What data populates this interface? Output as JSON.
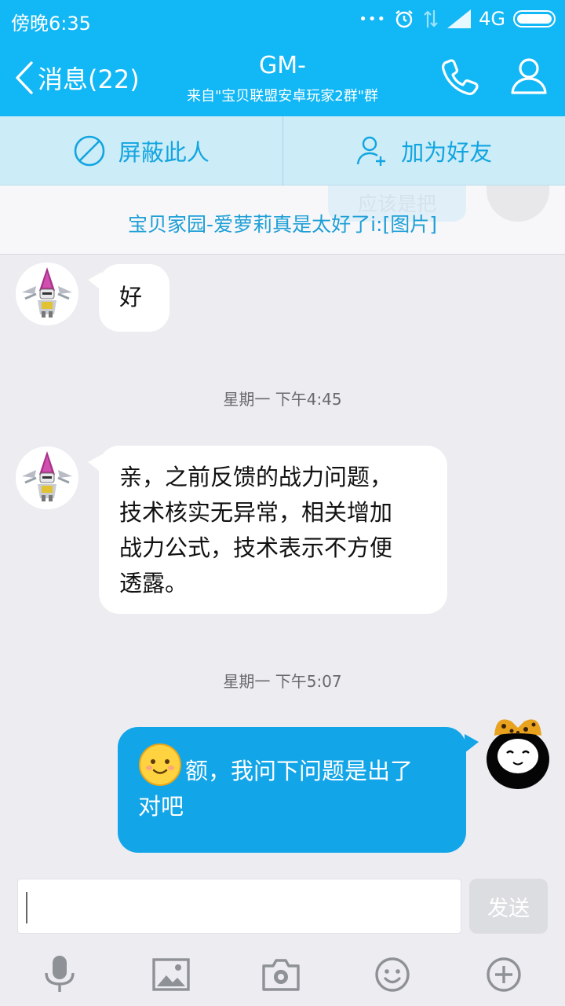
{
  "status_bar": {
    "time": "傍晚6:35",
    "dots": "•••",
    "network": "4G"
  },
  "nav": {
    "back_label": "消息(22)",
    "title": "GM-",
    "subtitle": "来自\"宝贝联盟安卓玩家2群\"群"
  },
  "actions": {
    "block_label": "屏蔽此人",
    "add_friend_label": "加为好友"
  },
  "notice": {
    "text": "宝贝家园-爱萝莉真是太好了i:[图片]",
    "ghost_text": "应该是把"
  },
  "messages": [
    {
      "sender": "GM-",
      "direction": "in",
      "text": "好"
    },
    {
      "timestamp": "星期一 下午4:45"
    },
    {
      "sender": "GM-",
      "direction": "in",
      "lines": [
        "亲，之前反馈的战力问题，",
        "技术核实无异常，相关增加",
        "战力公式，技术表示不方便",
        "透露。"
      ]
    },
    {
      "timestamp": "星期一 下午5:07"
    },
    {
      "sender": "me",
      "direction": "out",
      "emoji": "smile-emoji",
      "lines": [
        "额，我问下问题是出了",
        "对吧"
      ]
    }
  ],
  "composer": {
    "input_value": "",
    "send_label": "发送",
    "tools": [
      "microphone-icon",
      "image-icon",
      "camera-icon",
      "emoji-icon",
      "plus-icon"
    ]
  },
  "colors": {
    "brand": "#12b7f5",
    "out_bubble": "#12a5e8",
    "action_bar": "#ccecf8",
    "background": "#ececf1"
  }
}
